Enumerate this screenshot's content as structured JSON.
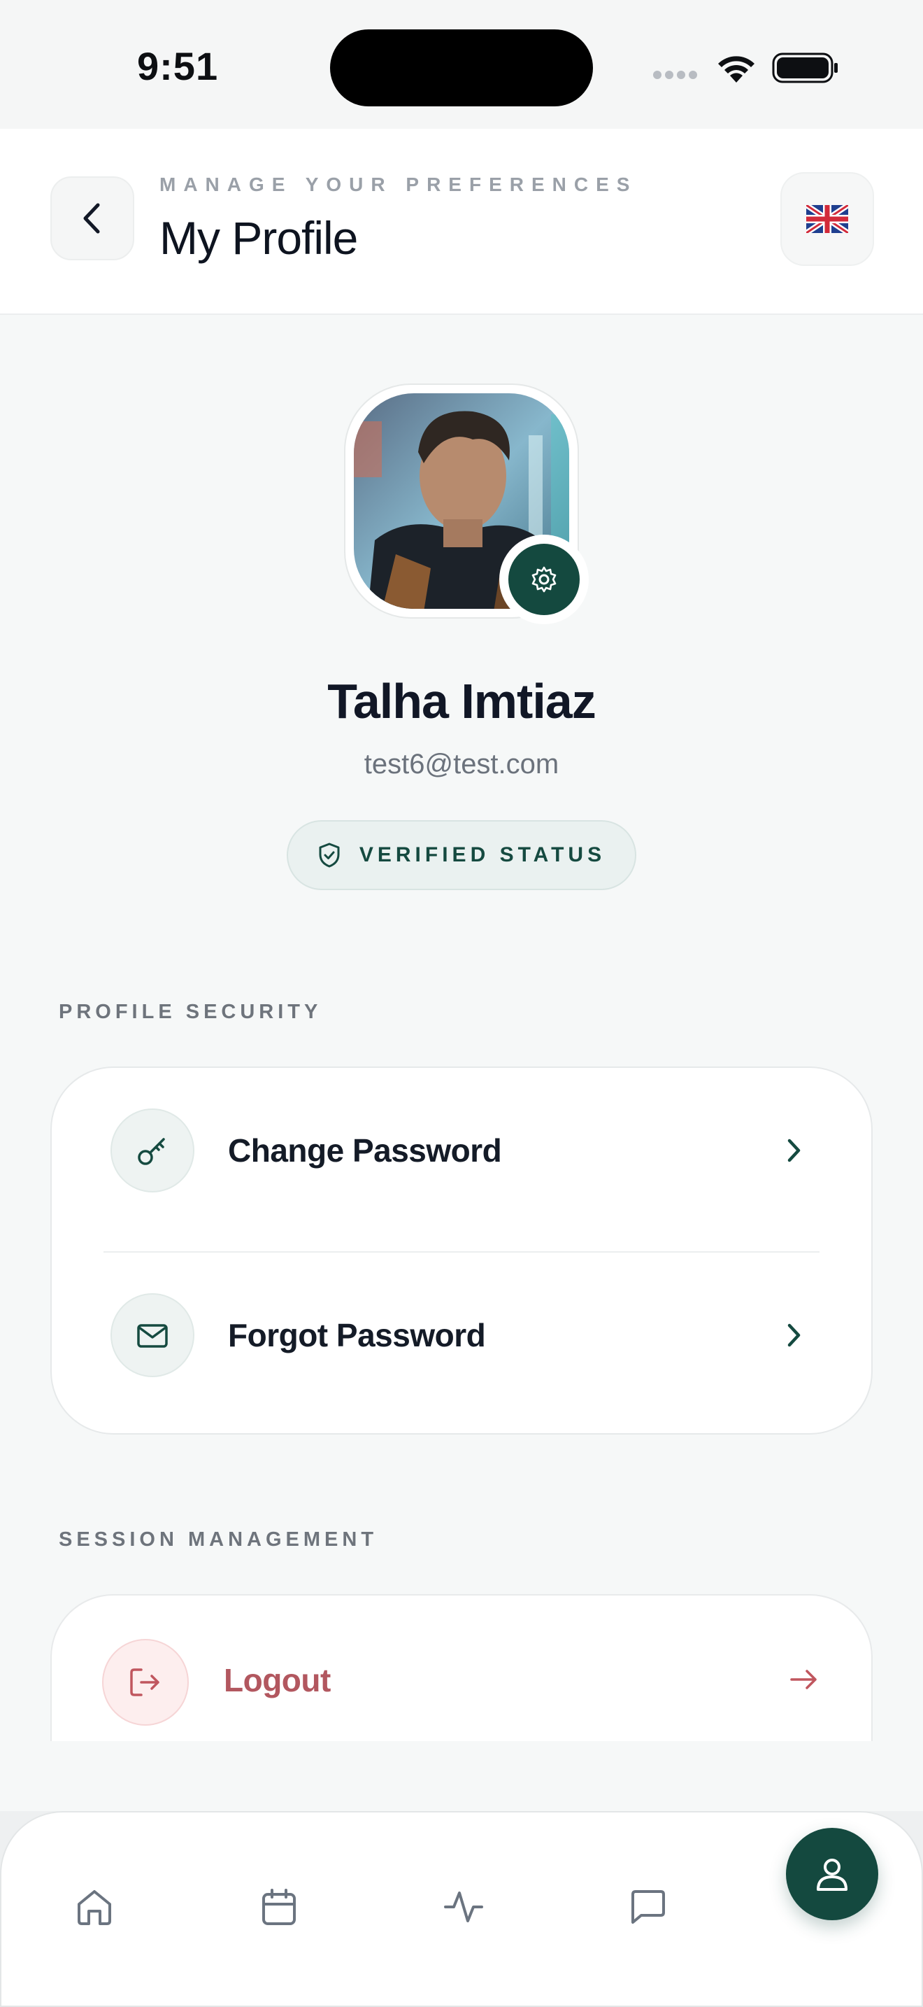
{
  "status_bar": {
    "time": "9:51"
  },
  "header": {
    "subtitle": "MANAGE YOUR PREFERENCES",
    "title": "My Profile",
    "language_flag": "uk-flag"
  },
  "profile": {
    "name": "Talha Imtiaz",
    "email": "test6@test.com",
    "badge": "VERIFIED STATUS"
  },
  "sections": {
    "security": {
      "title": "PROFILE SECURITY",
      "items": [
        {
          "label": "Change Password",
          "icon": "key-icon"
        },
        {
          "label": "Forgot Password",
          "icon": "mail-icon"
        }
      ]
    },
    "session": {
      "title": "SESSION MANAGEMENT",
      "logout_label": "Logout"
    }
  },
  "bottom_nav": {
    "items": [
      "home-icon",
      "calendar-icon",
      "activity-icon",
      "chat-icon",
      "profile-icon"
    ],
    "active": "profile-icon"
  },
  "colors": {
    "accent": "#14493f",
    "danger": "#b2575f",
    "background": "#f6f8f8"
  }
}
